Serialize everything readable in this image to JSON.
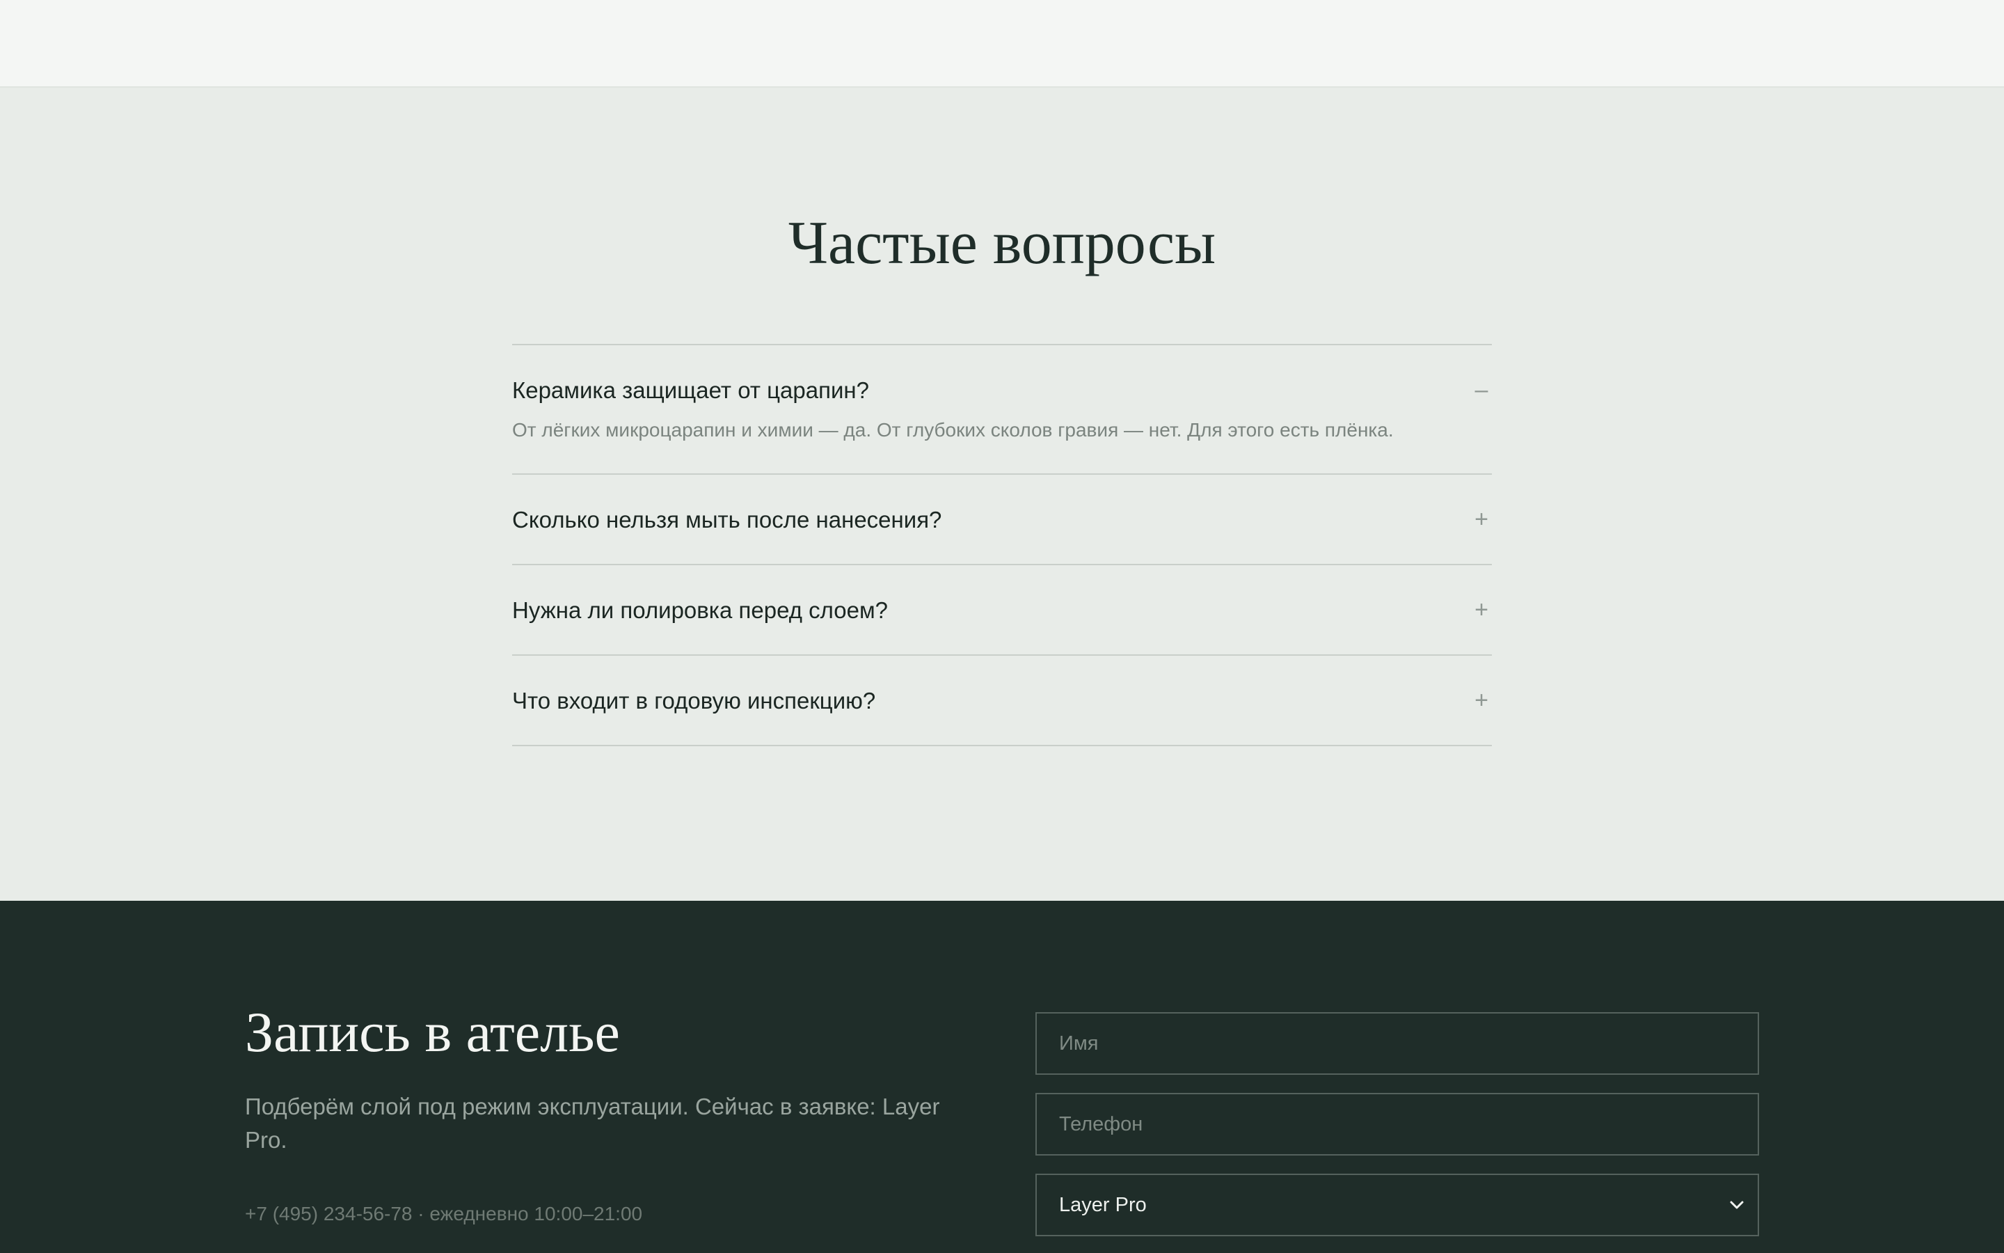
{
  "faq": {
    "title": "Частые вопросы",
    "items": [
      {
        "question": "Керамика защищает от царапин?",
        "toggle": "–",
        "answer": "От лёгких микроцарапин и химии — да. От глубоких сколов гравия — нет. Для этого есть плёнка."
      },
      {
        "question": "Сколько нельзя мыть после нанесения?",
        "toggle": "+"
      },
      {
        "question": "Нужна ли полировка перед слоем?",
        "toggle": "+"
      },
      {
        "question": "Что входит в годовую инспекцию?",
        "toggle": "+"
      }
    ]
  },
  "booking": {
    "title": "Запись в ателье",
    "subtitle": "Подберём слой под режим эксплуатации. Сейчас в заявке: Layer Pro.",
    "contact": "+7 (495) 234‑56‑78 · ежедневно 10:00–21:00",
    "form": {
      "name_placeholder": "Имя",
      "phone_placeholder": "Телефон",
      "package_value": "Layer Pro",
      "chevron_icon": "chevron-down-icon"
    }
  }
}
